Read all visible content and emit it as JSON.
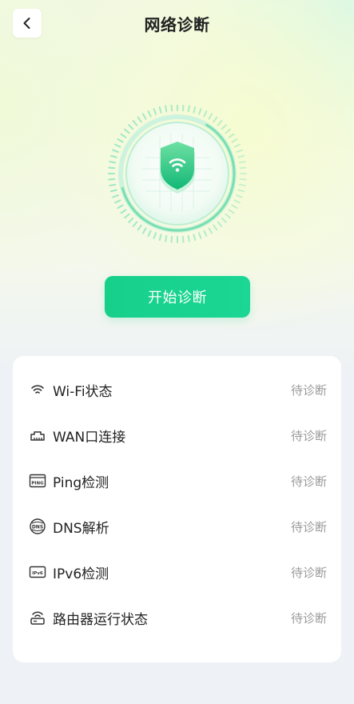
{
  "header": {
    "title": "网络诊断"
  },
  "diagnose": {
    "start_label": "开始诊断"
  },
  "icons": {
    "back": "chevron-left-icon",
    "shield": "shield-wifi-icon",
    "wifi": "wifi-icon",
    "wan": "ethernet-port-icon",
    "ping": "ping-icon",
    "dns": "dns-icon",
    "ipv6": "ipv6-icon",
    "router": "router-icon"
  },
  "colors": {
    "accent": "#16d08a",
    "status_text": "#9a9a9a"
  },
  "checks": {
    "items": [
      {
        "label": "Wi-Fi状态",
        "status": "待诊断"
      },
      {
        "label": "WAN口连接",
        "status": "待诊断"
      },
      {
        "label": "Ping检测",
        "status": "待诊断"
      },
      {
        "label": "DNS解析",
        "status": "待诊断"
      },
      {
        "label": "IPv6检测",
        "status": "待诊断"
      },
      {
        "label": "路由器运行状态",
        "status": "待诊断"
      }
    ]
  }
}
